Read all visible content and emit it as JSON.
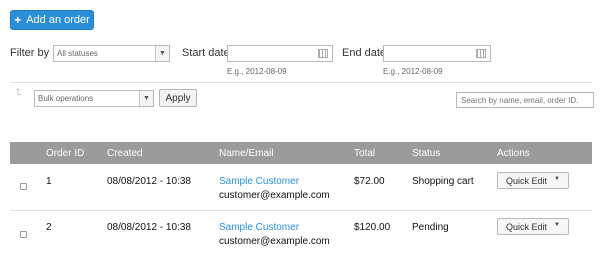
{
  "toolbar": {
    "add_order_label": "Add an order",
    "add_icon": "plus-icon"
  },
  "filters": {
    "filter_by_label": "Filter by",
    "status_value": "All statuses",
    "start_date_label": "Start date",
    "start_date_hint": "E.g., 2012-08-09",
    "end_date_label": "End date",
    "end_date_hint": "E.g., 2012-08-09"
  },
  "bulk": {
    "select_value": "Bulk operations",
    "apply_label": "Apply",
    "search_placeholder": "Search by name, email, order ID."
  },
  "table": {
    "headers": {
      "order_id": "Order ID",
      "created": "Created",
      "name_email": "Name/Email",
      "total": "Total",
      "status": "Status",
      "actions": "Actions"
    },
    "rows": [
      {
        "order_id": "1",
        "created": "08/08/2012 - 10:38",
        "name": "Sample Customer",
        "email": "customer@example.com",
        "total": "$72.00",
        "status": "Shopping cart",
        "action": "Quick Edit"
      },
      {
        "order_id": "2",
        "created": "08/08/2012 - 10:38",
        "name": "Sample Customer",
        "email": "customer@example.com",
        "total": "$120.00",
        "status": "Pending",
        "action": "Quick Edit"
      }
    ]
  },
  "colors": {
    "accent": "#2b8fd8",
    "header_bg": "#9b9b9b"
  }
}
